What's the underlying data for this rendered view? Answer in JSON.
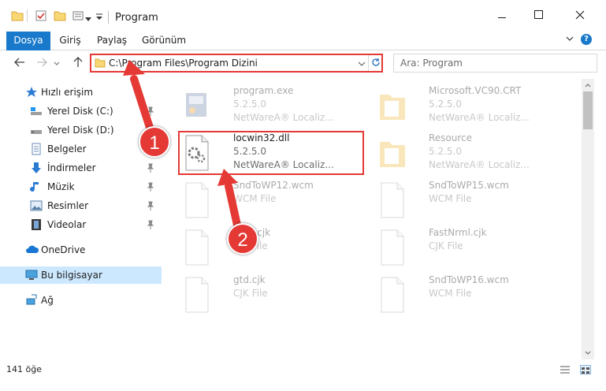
{
  "window": {
    "title": "Program",
    "minimize_icon": "minimize-icon",
    "maximize_icon": "maximize-icon",
    "close_icon": "close-icon"
  },
  "ribbon": {
    "tabs": [
      {
        "label": "Dosya"
      },
      {
        "label": "Giriş"
      },
      {
        "label": "Paylaş"
      },
      {
        "label": "Görünüm"
      }
    ],
    "help_label": "?"
  },
  "address": {
    "path": "C:\\Program Files\\Program Dizini",
    "search_placeholder": "Ara: Program"
  },
  "nav": {
    "items": [
      {
        "label": "Hızlı erişim",
        "icon": "star-icon"
      },
      {
        "label": "Yerel Disk (C:)",
        "icon": "drive-icon"
      },
      {
        "label": "Yerel Disk (D:)",
        "icon": "drive-icon"
      },
      {
        "label": "Belgeler",
        "icon": "documents-icon"
      },
      {
        "label": "İndirmeler",
        "icon": "download-icon"
      },
      {
        "label": "Müzik",
        "icon": "music-icon"
      },
      {
        "label": "Resimler",
        "icon": "pictures-icon"
      },
      {
        "label": "Videolar",
        "icon": "video-icon"
      },
      {
        "label": "OneDrive",
        "icon": "cloud-icon"
      },
      {
        "label": "Bu bilgisayar",
        "icon": "computer-icon"
      },
      {
        "label": "Ağ",
        "icon": "network-icon"
      }
    ]
  },
  "files": [
    {
      "name": "program.exe",
      "line2": "5.2.5.0",
      "line3": "NetWareA® Localiz...",
      "icon": "exe-icon"
    },
    {
      "name": "Microsoft.VC90.CRT",
      "line2": "5.2.5.0",
      "line3": "NetWareA® Localiz...",
      "icon": "folder-icon"
    },
    {
      "name": "locwin32.dll",
      "line2": "5.2.5.0",
      "line3": "NetWareA® Localiz...",
      "icon": "dll-icon"
    },
    {
      "name": "Resource",
      "line2": "5.2.5.0",
      "line3": "NetWareA® Localiz...",
      "icon": "folder-icon"
    },
    {
      "name": "SndToWP12.wcm",
      "line2": "WCM File",
      "line3": "",
      "icon": "file-icon"
    },
    {
      "name": "SndToWP15.wcm",
      "line2": "WCM File",
      "line3": "",
      "icon": "file-icon"
    },
    {
      "name": "Knf...cjk",
      "line2": "CJK File",
      "line3": "",
      "icon": "file-icon"
    },
    {
      "name": "FastNrml.cjk",
      "line2": "CJK File",
      "line3": "",
      "icon": "file-icon"
    },
    {
      "name": "gtd.cjk",
      "line2": "CJK File",
      "line3": "",
      "icon": "file-icon"
    },
    {
      "name": "SndToWP16.wcm",
      "line2": "WCM File",
      "line3": "",
      "icon": "file-icon"
    }
  ],
  "status": {
    "count": "141 öğe"
  },
  "annotations": {
    "step1": "1",
    "step2": "2",
    "color": "#e53935"
  },
  "colors": {
    "accent": "#1979ca",
    "selection": "#cce8ff",
    "annotation": "#e53935"
  }
}
